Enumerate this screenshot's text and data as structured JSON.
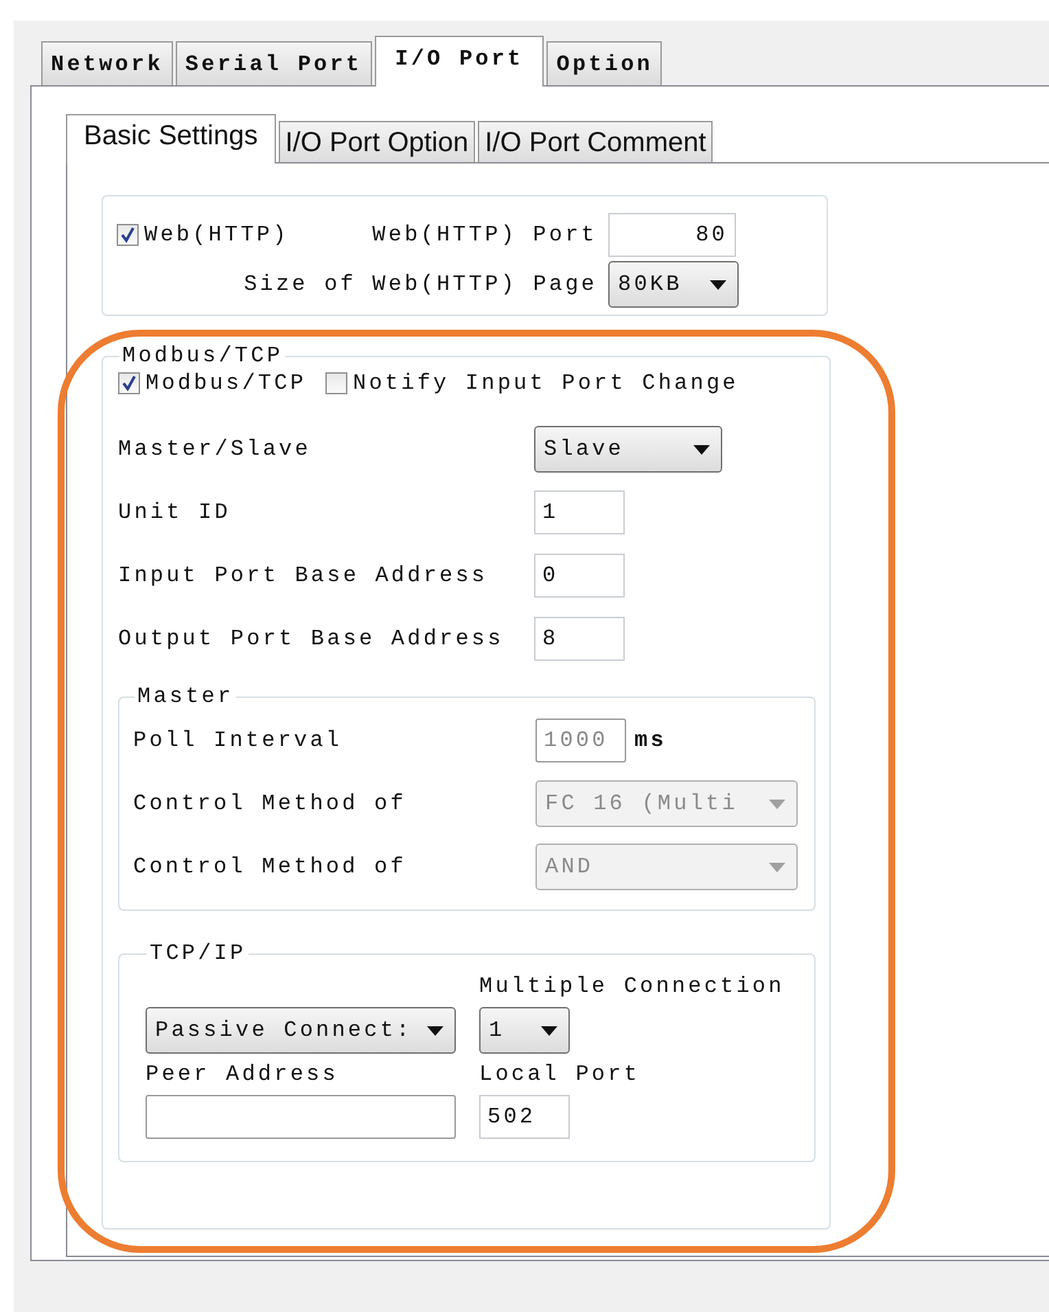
{
  "tabs": [
    {
      "label": "Network",
      "selected": false
    },
    {
      "label": "Serial Port",
      "selected": false
    },
    {
      "label": "I/O Port",
      "selected": true
    },
    {
      "label": "Option",
      "selected": false
    }
  ],
  "subtabs": [
    {
      "label": "Basic Settings",
      "selected": true
    },
    {
      "label": "I/O Port Option",
      "selected": false
    },
    {
      "label": "I/O Port Comment",
      "selected": false
    }
  ],
  "web": {
    "enabled": {
      "label": "Web(HTTP)",
      "checked": true
    },
    "port": {
      "label": "Web(HTTP) Port",
      "value": "80"
    },
    "page_size": {
      "label": "Size of Web(HTTP) Page",
      "value": "80KB"
    }
  },
  "modbus": {
    "title": "Modbus/TCP",
    "options": [
      {
        "label": "Modbus/TCP",
        "checked": true
      },
      {
        "label": "Notify Input Port Change",
        "checked": false
      }
    ],
    "fields": [
      {
        "kind": "select",
        "label": "Master/Slave",
        "value": "Slave"
      },
      {
        "kind": "input",
        "label": "Unit ID",
        "value": "1"
      },
      {
        "kind": "input",
        "label": "Input Port Base Address",
        "value": "0"
      },
      {
        "kind": "input",
        "label": "Output Port Base Address",
        "value": "8"
      }
    ],
    "master": {
      "title": "Master",
      "fields": [
        {
          "kind": "input",
          "label": "Poll Interval",
          "value": "1000",
          "unit": "ms",
          "disabled": true
        },
        {
          "kind": "select",
          "label": "Control Method of",
          "value": "FC 16 (Multi",
          "disabled": true
        },
        {
          "kind": "select",
          "label": "Control Method of",
          "value": "AND",
          "disabled": true
        }
      ]
    },
    "tcpip": {
      "title": "TCP/IP",
      "mode": {
        "value": "Passive Connect:"
      },
      "multiple_connection": {
        "label": "Multiple Connection",
        "value": "1"
      },
      "peer_address": {
        "label": "Peer Address"
      },
      "local_port": {
        "label": "Local Port",
        "value": "502"
      }
    }
  },
  "highlight": {
    "shown": true
  }
}
